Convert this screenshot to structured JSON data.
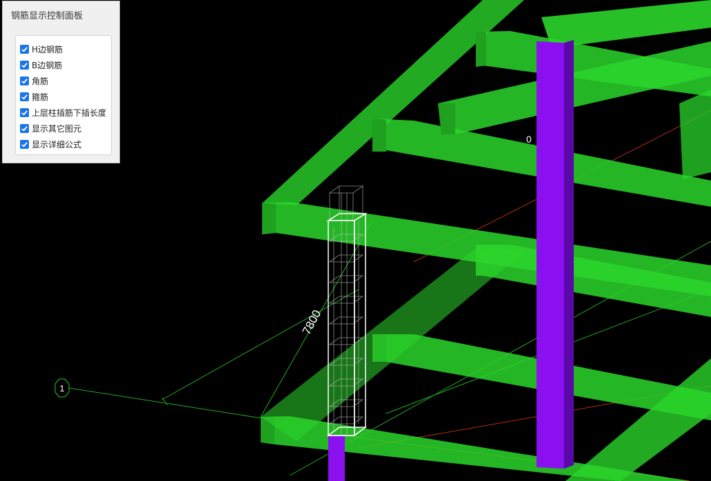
{
  "panel": {
    "title": "钢筋显示控制面板",
    "options": [
      {
        "label": "H边钢筋",
        "checked": true
      },
      {
        "label": "B边钢筋",
        "checked": true
      },
      {
        "label": "角筋",
        "checked": true
      },
      {
        "label": "箍筋",
        "checked": true
      },
      {
        "label": "上层柱插筋下插长度",
        "checked": true
      },
      {
        "label": "显示其它图元",
        "checked": true
      },
      {
        "label": "显示详细公式",
        "checked": true
      }
    ]
  },
  "viewport": {
    "dimension_label": "7800",
    "axis_label": "1",
    "small_label": "0"
  },
  "colors": {
    "background": "#000000",
    "beam": "#2bd62b",
    "beam_dark": "#1a8f1a",
    "column": "#8a10f0",
    "rebar": "#ffffff",
    "grid_line": "#22aa22",
    "axis_line": "#b03010",
    "checkbox": "#1a73e8"
  }
}
